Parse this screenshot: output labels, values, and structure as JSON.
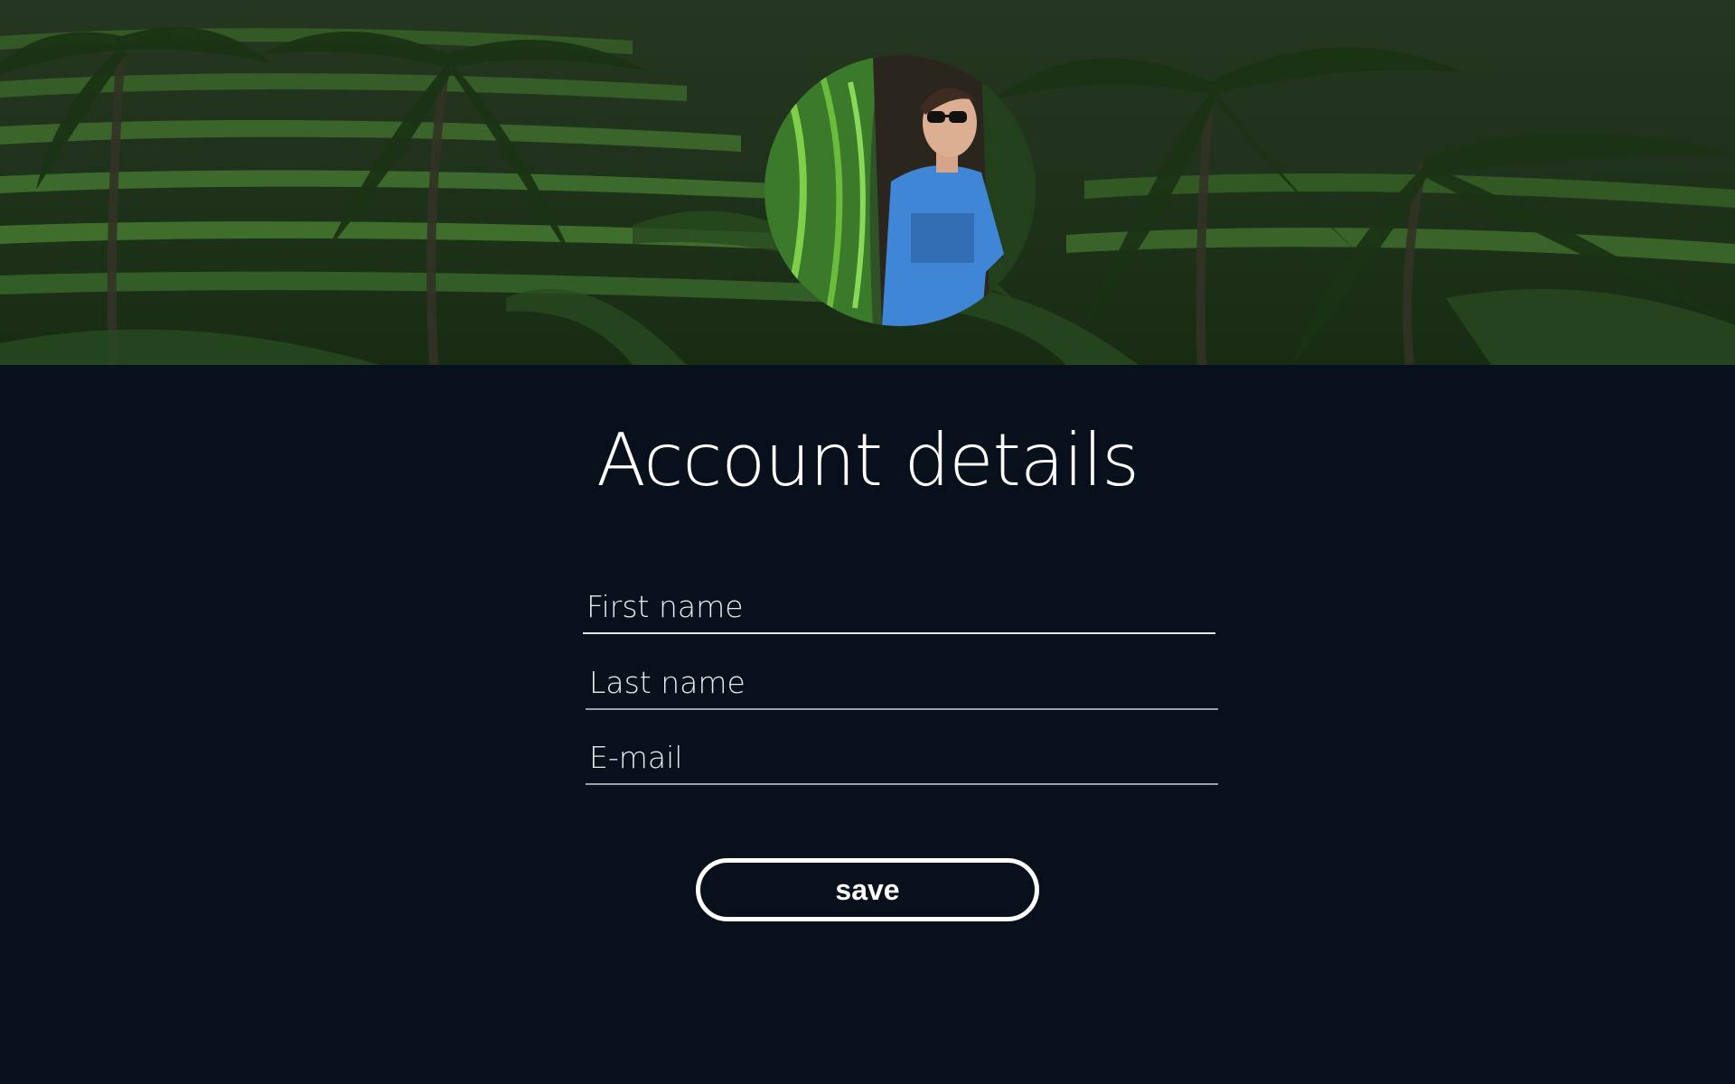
{
  "hero": {
    "background_icon": "jungle-photo",
    "accent_color": "#2a4a22"
  },
  "profile": {
    "avatar_icon": "user-avatar-photo"
  },
  "form": {
    "title": "Account details",
    "first_name": {
      "value": "",
      "placeholder": "First name"
    },
    "last_name": {
      "value": "",
      "placeholder": "Last name"
    },
    "email": {
      "value": "",
      "placeholder": "E-mail"
    },
    "save_label": "save"
  },
  "colors": {
    "background": "#08111b",
    "text": "#ffffff",
    "field_underline": "#9aa0a6"
  }
}
